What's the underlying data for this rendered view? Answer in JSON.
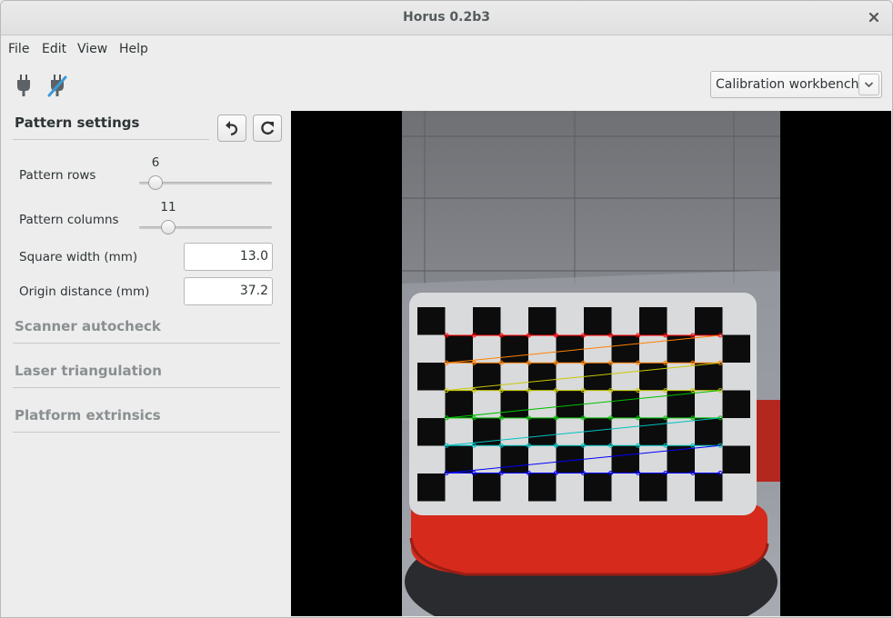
{
  "window": {
    "title": "Horus 0.2b3"
  },
  "menu": {
    "items": [
      "File",
      "Edit",
      "View",
      "Help"
    ]
  },
  "toolbar": {
    "connect_icon": "plug-icon",
    "disconnect_icon": "plug-disconnected-icon",
    "workbench": {
      "selected": "Calibration workbench"
    }
  },
  "pattern_settings": {
    "title": "Pattern settings",
    "undo_icon": "undo-icon",
    "reset_icon": "refresh-icon",
    "rows": {
      "label": "Pattern rows",
      "value": "6"
    },
    "columns": {
      "label": "Pattern columns",
      "value": "11"
    },
    "square_width": {
      "label": "Square width (mm)",
      "value": "13.0"
    },
    "origin_distance": {
      "label": "Origin distance (mm)",
      "value": "37.2"
    }
  },
  "sections": {
    "scanner_autocheck": "Scanner autocheck",
    "laser_triangulation": "Laser triangulation",
    "platform_extrinsics": "Platform extrinsics"
  },
  "colors": {
    "window_bg": "#ededed",
    "video_bg": "#000000",
    "platform_red": "#d52a1c",
    "corner_rows": [
      "#ff0000",
      "#ff8000",
      "#c8c800",
      "#00c000",
      "#00c0c0",
      "#0000ff"
    ]
  }
}
